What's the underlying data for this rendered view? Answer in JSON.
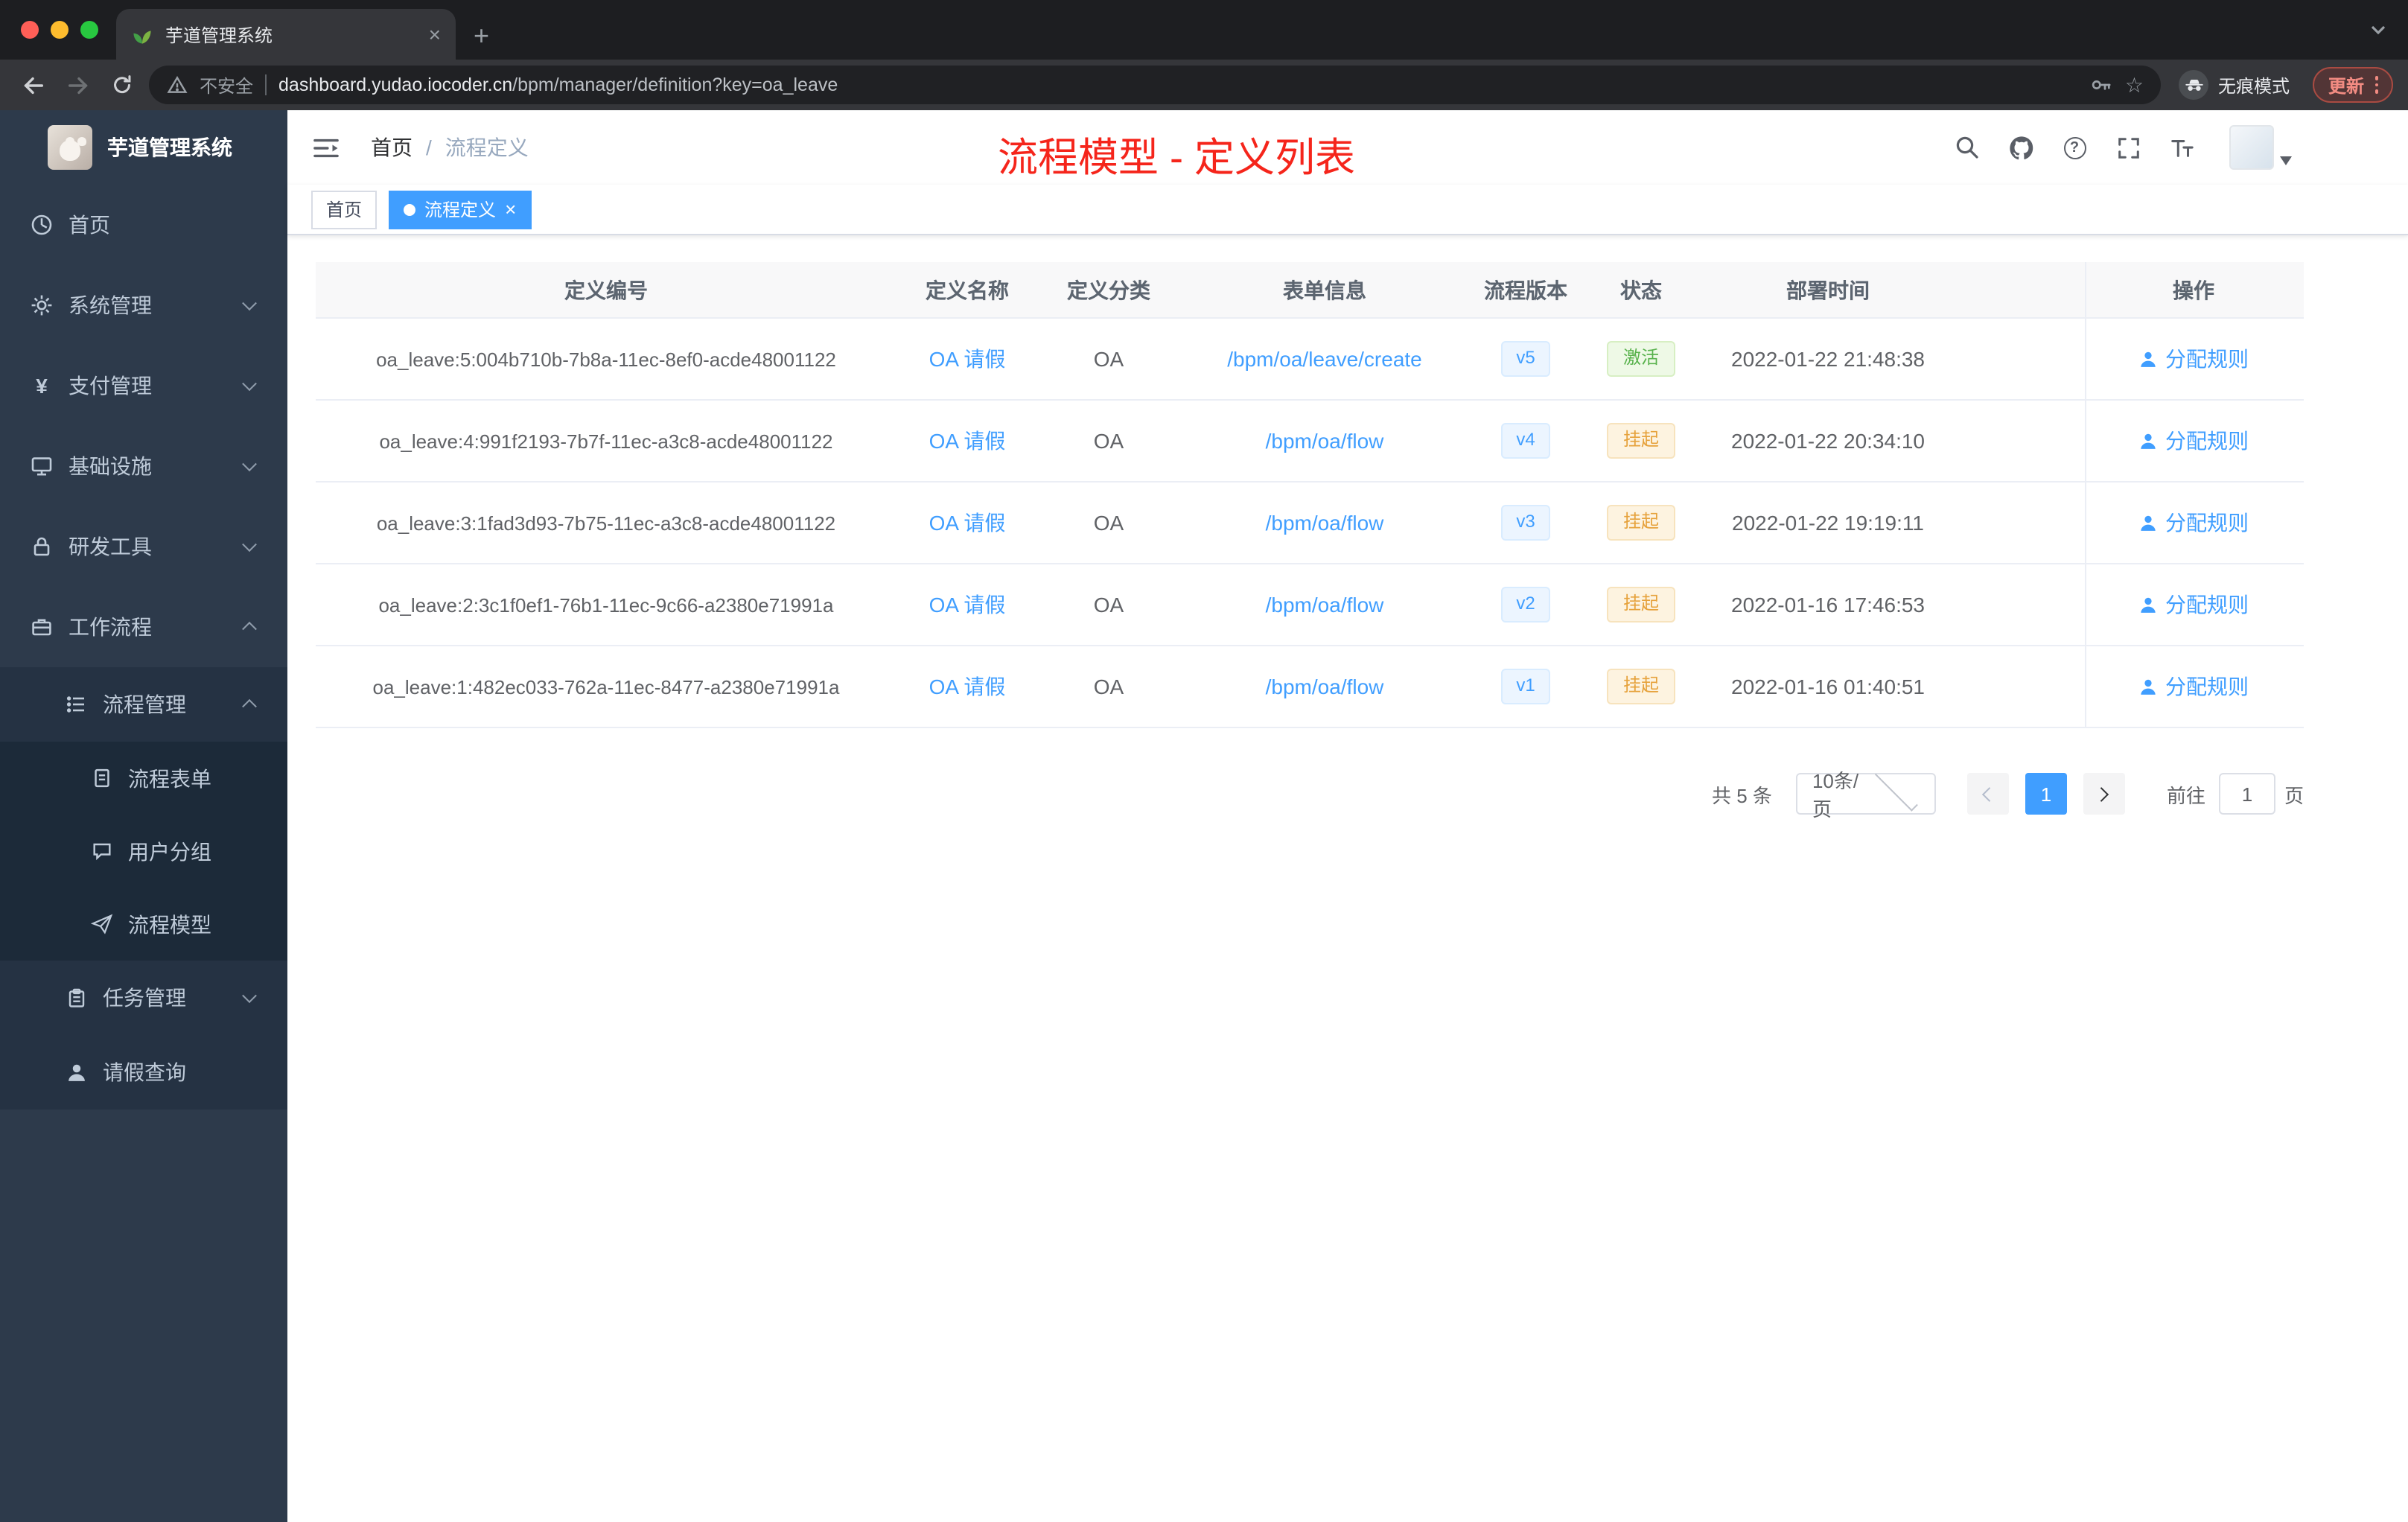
{
  "browser": {
    "tab_title": "芋道管理系统",
    "security_label": "不安全",
    "url_domain": "dashboard.yudao.iocoder.cn",
    "url_path": "/bpm/manager/definition?key=oa_leave",
    "incognito_label": "无痕模式",
    "update_label": "更新"
  },
  "sidebar": {
    "logo_title": "芋道管理系统",
    "items": [
      {
        "label": "首页"
      },
      {
        "label": "系统管理"
      },
      {
        "label": "支付管理"
      },
      {
        "label": "基础设施"
      },
      {
        "label": "研发工具"
      },
      {
        "label": "工作流程"
      },
      {
        "label": "流程管理"
      },
      {
        "label": "流程表单"
      },
      {
        "label": "用户分组"
      },
      {
        "label": "流程模型"
      },
      {
        "label": "任务管理"
      },
      {
        "label": "请假查询"
      }
    ]
  },
  "header": {
    "breadcrumb_home": "首页",
    "breadcrumb_separator": "/",
    "breadcrumb_current": "流程定义",
    "overlay_title": "流程模型 - 定义列表"
  },
  "tags": {
    "home": "首页",
    "current": "流程定义"
  },
  "table": {
    "columns": [
      "定义编号",
      "定义名称",
      "定义分类",
      "表单信息",
      "流程版本",
      "状态",
      "部署时间",
      "操作"
    ],
    "rows": [
      {
        "id": "oa_leave:5:004b710b-7b8a-11ec-8ef0-acde48001122",
        "name": "OA 请假",
        "category": "OA",
        "form": "/bpm/oa/leave/create",
        "version": "v5",
        "status": "激活",
        "time": "2022-01-22 21:48:38",
        "action": "分配规则"
      },
      {
        "id": "oa_leave:4:991f2193-7b7f-11ec-a3c8-acde48001122",
        "name": "OA 请假",
        "category": "OA",
        "form": "/bpm/oa/flow",
        "version": "v4",
        "status": "挂起",
        "time": "2022-01-22 20:34:10",
        "action": "分配规则"
      },
      {
        "id": "oa_leave:3:1fad3d93-7b75-11ec-a3c8-acde48001122",
        "name": "OA 请假",
        "category": "OA",
        "form": "/bpm/oa/flow",
        "version": "v3",
        "status": "挂起",
        "time": "2022-01-22 19:19:11",
        "action": "分配规则"
      },
      {
        "id": "oa_leave:2:3c1f0ef1-76b1-11ec-9c66-a2380e71991a",
        "name": "OA 请假",
        "category": "OA",
        "form": "/bpm/oa/flow",
        "version": "v2",
        "status": "挂起",
        "time": "2022-01-16 17:46:53",
        "action": "分配规则"
      },
      {
        "id": "oa_leave:1:482ec033-762a-11ec-8477-a2380e71991a",
        "name": "OA 请假",
        "category": "OA",
        "form": "/bpm/oa/flow",
        "version": "v1",
        "status": "挂起",
        "time": "2022-01-16 01:40:51",
        "action": "分配规则"
      }
    ]
  },
  "pagination": {
    "total": "共 5 条",
    "page_size": "10条/页",
    "current_page": "1",
    "goto_label": "前往",
    "goto_value": "1",
    "page_unit": "页"
  },
  "colors": {
    "accent": "#409eff",
    "success": "#58b24c",
    "warning": "#e6a23c",
    "annotation_red": "#f5251b",
    "sidebar_bg": "#2d3a4b"
  }
}
